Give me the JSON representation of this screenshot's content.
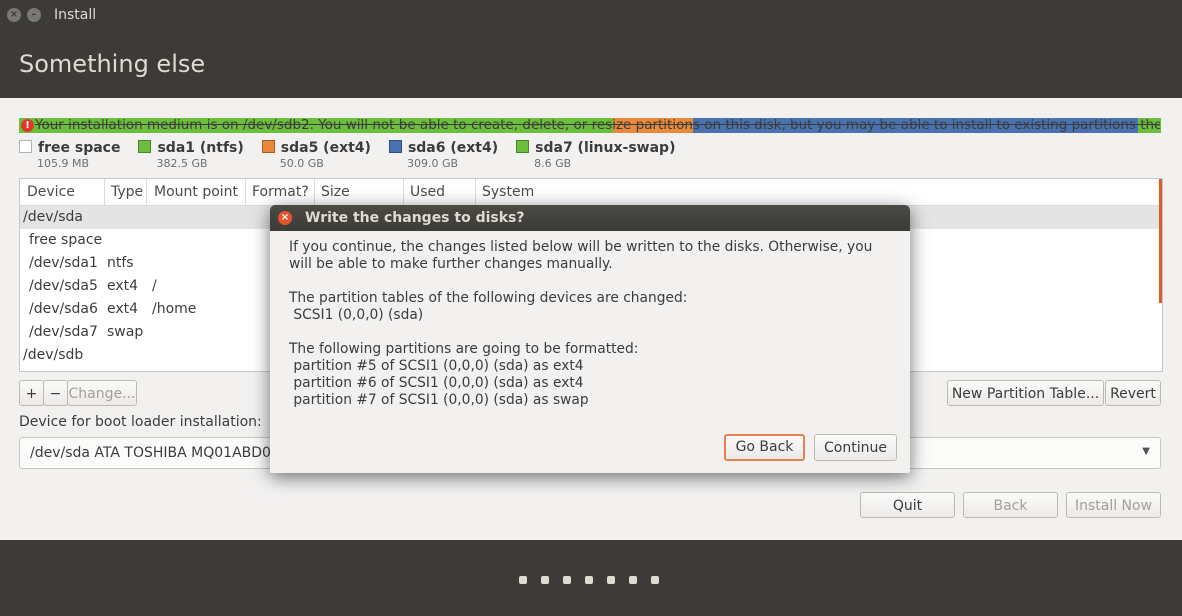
{
  "window": {
    "title": "Install",
    "close_icon": "×",
    "minimize_icon": "–"
  },
  "header": {
    "title": "Something else"
  },
  "warning": {
    "text": "Your installation medium is on /dev/sdb2. You will not be able to create, delete, or resize partitions on this disk, but you may be able to install to existing partitions there.",
    "icon": "!"
  },
  "partition_bar": {
    "segments": [
      {
        "color": "#6cbe3d",
        "fraction": 0.52
      },
      {
        "color": "#e98a3a",
        "fraction": 0.07
      },
      {
        "color": "#4a72b0",
        "fraction": 0.39
      },
      {
        "color": "#6cbe3d",
        "fraction": 0.02
      }
    ]
  },
  "legend": [
    {
      "name": "free space",
      "size": "105.9 MB",
      "color": "#ffffff"
    },
    {
      "name": "sda1 (ntfs)",
      "size": "382.5 GB",
      "color": "#6cbe3d"
    },
    {
      "name": "sda5 (ext4)",
      "size": "50.0 GB",
      "color": "#e98a3a"
    },
    {
      "name": "sda6 (ext4)",
      "size": "309.0 GB",
      "color": "#4a72b0"
    },
    {
      "name": "sda7 (linux-swap)",
      "size": "8.6 GB",
      "color": "#6cbe3d"
    }
  ],
  "table": {
    "columns": [
      "Device",
      "Type",
      "Mount point",
      "Format?",
      "Size",
      "Used",
      "System"
    ],
    "rows": [
      {
        "device": "/dev/sda",
        "type": "",
        "mount": ""
      },
      {
        "device": "free space",
        "type": "",
        "mount": ""
      },
      {
        "device": "/dev/sda1",
        "type": "ntfs",
        "mount": ""
      },
      {
        "device": "/dev/sda5",
        "type": "ext4",
        "mount": "/"
      },
      {
        "device": "/dev/sda6",
        "type": "ext4",
        "mount": "/home"
      },
      {
        "device": "/dev/sda7",
        "type": "swap",
        "mount": ""
      },
      {
        "device": "/dev/sdb",
        "type": "",
        "mount": ""
      }
    ]
  },
  "toolbar": {
    "add_label": "+",
    "remove_label": "−",
    "change_label": "Change...",
    "new_table_label": "New Partition Table...",
    "revert_label": "Revert"
  },
  "boot": {
    "label": "Device for boot loader installation:",
    "value": "/dev/sda    ATA TOSHIBA MQ01ABD0"
  },
  "nav": {
    "quit": "Quit",
    "back": "Back",
    "install": "Install Now"
  },
  "progress_dots": 7,
  "dialog": {
    "title": "Write the changes to disks?",
    "close_icon": "×",
    "intro": "If you continue, the changes listed below will be written to the disks. Otherwise, you will be able to make further changes manually.",
    "tables_heading": "The partition tables of the following devices are changed:",
    "tables_items": [
      " SCSI1 (0,0,0) (sda)"
    ],
    "format_heading": "The following partitions are going to be formatted:",
    "format_items": [
      " partition #5 of SCSI1 (0,0,0) (sda) as ext4",
      " partition #6 of SCSI1 (0,0,0) (sda) as ext4",
      " partition #7 of SCSI1 (0,0,0) (sda) as swap"
    ],
    "go_back": "Go Back",
    "continue": "Continue"
  }
}
